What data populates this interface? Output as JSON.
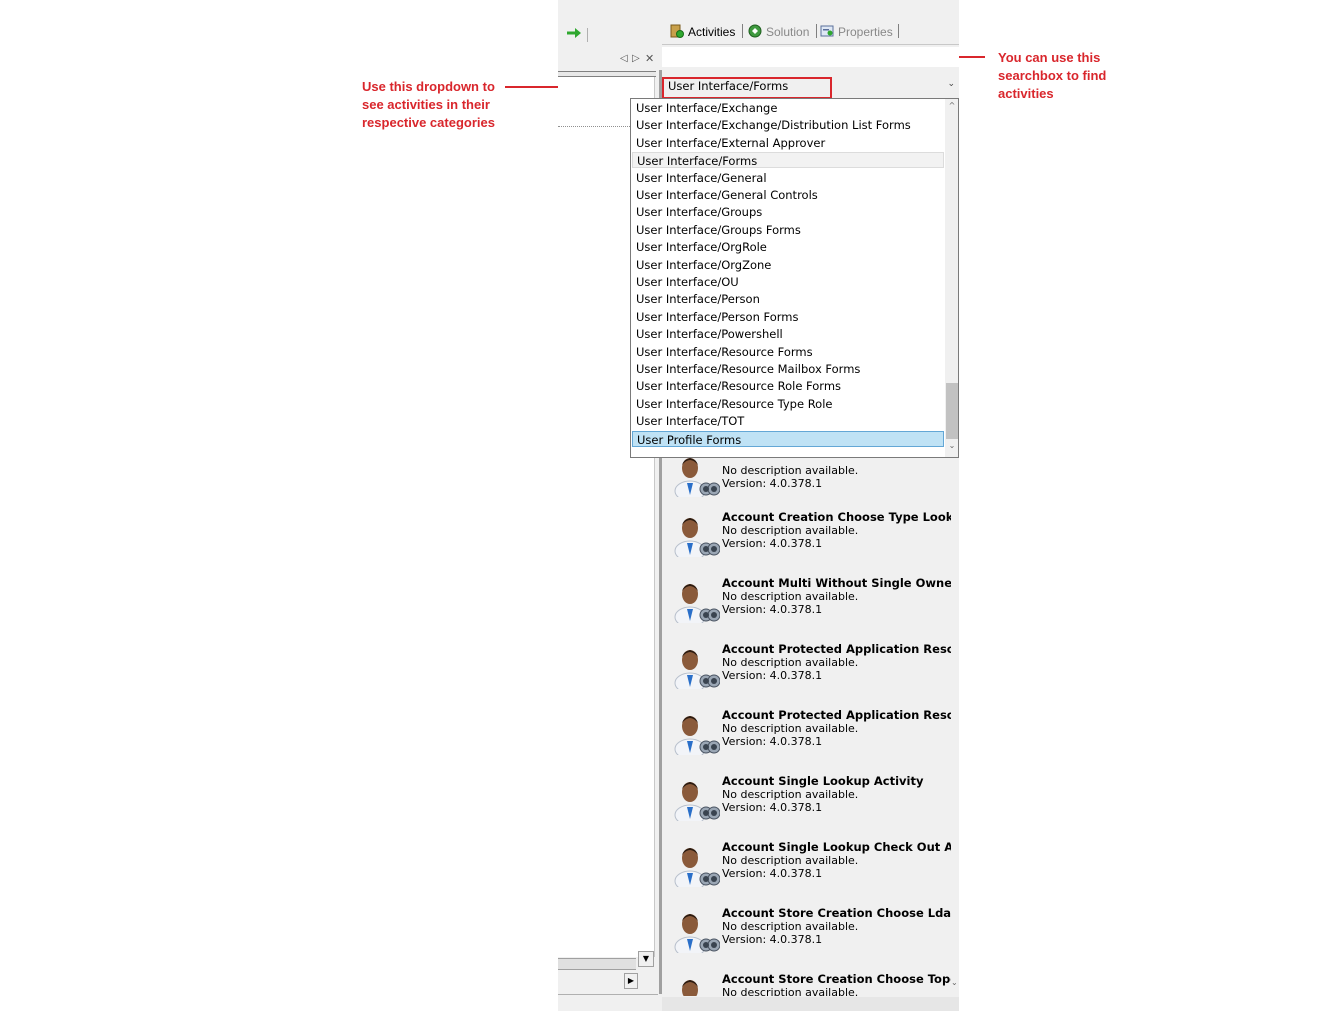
{
  "annotations": {
    "dropdown_note": "Use this dropdown to see activities in their respective categories",
    "search_note": "You can use this searchbox to find activities"
  },
  "left_pane": {
    "nav_prev": "◁",
    "nav_next": "▷",
    "close": "✕",
    "scroll_down": "▼",
    "scroll_right": "▶"
  },
  "tabs": [
    {
      "label": "Activities",
      "icon": "activities-icon",
      "active": true
    },
    {
      "label": "Solution",
      "icon": "solution-icon",
      "active": false
    },
    {
      "label": "Properties",
      "icon": "properties-icon",
      "active": false
    }
  ],
  "search": {
    "value": "",
    "placeholder": ""
  },
  "category_combo": {
    "selected": "User Interface/Forms",
    "arrow": "⌄"
  },
  "dropdown": {
    "items": [
      "User Interface/Exchange",
      "User Interface/Exchange/Distribution List Forms",
      "User Interface/External Approver",
      "User Interface/Forms",
      "User Interface/General",
      "User Interface/General Controls",
      "User Interface/Groups",
      "User Interface/Groups Forms",
      "User Interface/OrgRole",
      "User Interface/OrgZone",
      "User Interface/OU",
      "User Interface/Person",
      "User Interface/Person Forms",
      "User Interface/Powershell",
      "User Interface/Resource Forms",
      "User Interface/Resource Mailbox Forms",
      "User Interface/Resource Role Forms",
      "User Interface/Resource Type Role",
      "User Interface/TOT",
      "User Profile Forms"
    ],
    "current_index": 3,
    "hover_index": 19,
    "scroll_up": "^",
    "scroll_down": "⌄"
  },
  "activities": [
    {
      "name": "",
      "desc": "No description available.",
      "version": "Version:  4.0.378.1"
    },
    {
      "name": "Account Creation Choose Type Look",
      "desc": "No description available.",
      "version": "Version:  4.0.378.1"
    },
    {
      "name": "Account Multi Without Single Owner",
      "desc": "No description available.",
      "version": "Version:  4.0.378.1"
    },
    {
      "name": "Account Protected Application Reso",
      "desc": "No description available.",
      "version": "Version:  4.0.378.1"
    },
    {
      "name": "Account Protected Application Reso",
      "desc": "No description available.",
      "version": "Version:  4.0.378.1"
    },
    {
      "name": "Account Single Lookup Activity",
      "desc": "No description available.",
      "version": "Version:  4.0.378.1"
    },
    {
      "name": "Account Single Lookup Check Out A",
      "desc": "No description available.",
      "version": "Version:  4.0.378.1"
    },
    {
      "name": "Account Store Creation Choose Ldap",
      "desc": "No description available.",
      "version": "Version:  4.0.378.1"
    },
    {
      "name": "Account Store Creation Choose Topo",
      "desc": "No description available.",
      "version": ""
    }
  ],
  "list_scroll_down": "⌄",
  "colors": {
    "annotation": "#d9262c",
    "hover": "#bfe2f5",
    "hover_border": "#63a7d6",
    "panel": "#f0f0f0",
    "arrow_green": "#2fa82f"
  }
}
